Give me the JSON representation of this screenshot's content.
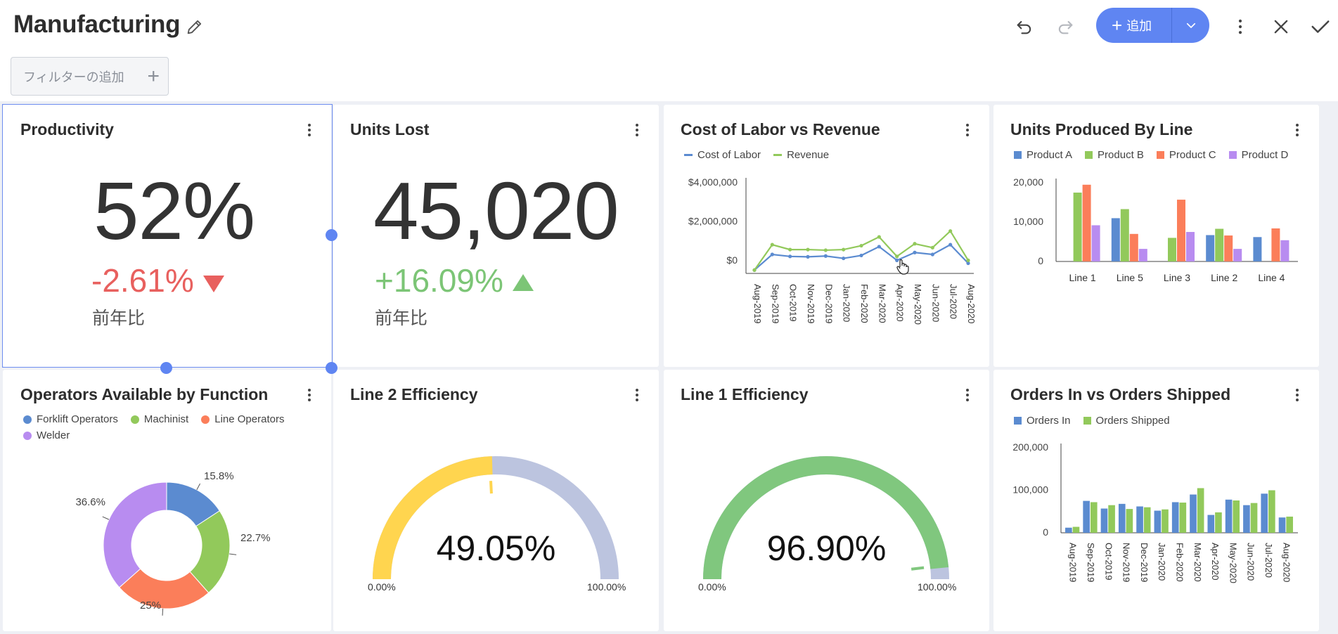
{
  "header": {
    "title": "Manufacturing",
    "add_label": "追加",
    "filter_placeholder": "フィルターの追加"
  },
  "colors": {
    "accent": "#5f85f2",
    "blue": "#5b8bd0",
    "green": "#92c95b",
    "orange": "#fb7e5a",
    "purple": "#b88cf0",
    "negative": "#e8605e",
    "positive": "#7cc576",
    "gauge_yellow": "#ffd54f",
    "gauge_green": "#80c77e",
    "gauge_track": "#bcc4df"
  },
  "cards": {
    "productivity": {
      "title": "Productivity",
      "value": "52%",
      "delta": "-2.61%",
      "delta_dir": "down",
      "sub": "前年比"
    },
    "units_lost": {
      "title": "Units Lost",
      "value": "45,020",
      "delta": "+16.09%",
      "delta_dir": "up",
      "sub": "前年比"
    },
    "cost_labor": {
      "title": "Cost of Labor vs Revenue"
    },
    "units_produced": {
      "title": "Units Produced By Line"
    },
    "operators": {
      "title": "Operators Available by Function"
    },
    "line2": {
      "title": "Line 2 Efficiency",
      "value": "49.05%",
      "min_label": "0.00%",
      "max_label": "100.00%"
    },
    "line1": {
      "title": "Line 1 Efficiency",
      "value": "96.90%",
      "min_label": "0.00%",
      "max_label": "100.00%"
    },
    "orders": {
      "title": "Orders In vs Orders Shipped"
    }
  },
  "chart_data": [
    {
      "id": "cost_labor",
      "type": "line",
      "x": [
        "Aug-2019",
        "Sep-2019",
        "Oct-2019",
        "Nov-2019",
        "Dec-2019",
        "Jan-2020",
        "Feb-2020",
        "Mar-2020",
        "Apr-2020",
        "May-2020",
        "Jun-2020",
        "Jul-2020",
        "Aug-2020"
      ],
      "series": [
        {
          "name": "Cost of Labor",
          "color": "#5b8bd0",
          "values": [
            100000,
            900000,
            800000,
            780000,
            820000,
            700000,
            850000,
            1300000,
            600000,
            1000000,
            900000,
            1400000,
            450000
          ]
        },
        {
          "name": "Revenue",
          "color": "#92c95b",
          "values": [
            100000,
            1400000,
            1150000,
            1150000,
            1120000,
            1150000,
            1350000,
            1800000,
            800000,
            1450000,
            1250000,
            2100000,
            600000
          ]
        }
      ],
      "y_ticks": [
        "$4,000,000",
        "$2,000,000",
        "$0"
      ],
      "ylim": [
        0,
        4000000
      ],
      "legend": "top-left",
      "grid": false
    },
    {
      "id": "units_produced",
      "type": "bar",
      "categories": [
        "Line 1",
        "Line 5",
        "Line 3",
        "Line 2",
        "Line 4"
      ],
      "series": [
        {
          "name": "Product A",
          "color": "#5b8bd0",
          "values": [
            null,
            11000,
            null,
            6700,
            6200
          ]
        },
        {
          "name": "Product B",
          "color": "#92c95b",
          "values": [
            17500,
            13300,
            6000,
            8300,
            null
          ]
        },
        {
          "name": "Product C",
          "color": "#fb7e5a",
          "values": [
            19500,
            7000,
            15700,
            6600,
            8400
          ]
        },
        {
          "name": "Product D",
          "color": "#b88cf0",
          "values": [
            9200,
            3200,
            7500,
            3200,
            5400
          ]
        }
      ],
      "y_ticks": [
        "20,000",
        "10,000",
        "0"
      ],
      "ylim": [
        0,
        20000
      ],
      "legend": "top-left",
      "grid": false
    },
    {
      "id": "operators",
      "type": "pie",
      "labels": [
        "Forklift Operators",
        "Machinist",
        "Line Operators",
        "Welder"
      ],
      "values": [
        15.8,
        22.7,
        25,
        36.6
      ],
      "value_labels": [
        "15.8%",
        "22.7%",
        "25%",
        "36.6%"
      ],
      "colors": [
        "#5b8bd0",
        "#92c95b",
        "#fb7e5a",
        "#b88cf0"
      ],
      "legend": "top-left"
    },
    {
      "id": "orders",
      "type": "bar",
      "categories": [
        "Aug-2019",
        "Sep-2019",
        "Oct-2019",
        "Nov-2019",
        "Dec-2019",
        "Jan-2020",
        "Feb-2020",
        "Mar-2020",
        "Apr-2020",
        "May-2020",
        "Jun-2020",
        "Jul-2020",
        "Aug-2020"
      ],
      "series": [
        {
          "name": "Orders In",
          "color": "#5b8bd0",
          "values": [
            12000,
            75000,
            57000,
            68000,
            62000,
            52000,
            72000,
            90000,
            42000,
            78000,
            65000,
            92000,
            36000
          ]
        },
        {
          "name": "Orders Shipped",
          "color": "#92c95b",
          "values": [
            14000,
            72000,
            65000,
            56000,
            60000,
            55000,
            71000,
            105000,
            48000,
            76000,
            70000,
            100000,
            38000
          ]
        }
      ],
      "y_ticks": [
        "200,000",
        "100,000",
        "0"
      ],
      "ylim": [
        0,
        200000
      ],
      "legend": "top-left",
      "grid": false
    },
    {
      "id": "line2",
      "type": "gauge",
      "value": 49.05,
      "range": [
        0,
        100
      ],
      "color": "#ffd54f"
    },
    {
      "id": "line1",
      "type": "gauge",
      "value": 96.9,
      "range": [
        0,
        100
      ],
      "color": "#80c77e"
    }
  ]
}
